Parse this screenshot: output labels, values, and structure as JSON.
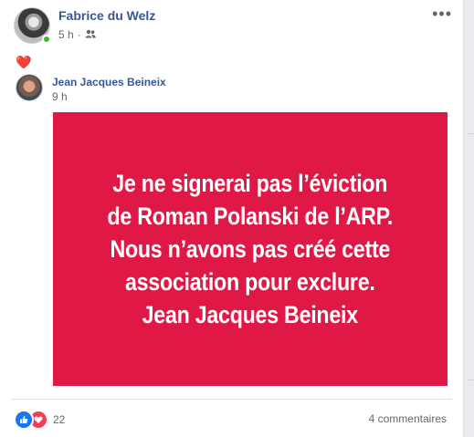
{
  "post": {
    "author": "Fabrice du Welz",
    "time": "5 h",
    "separator": "·",
    "audience_icon": "friends-icon",
    "more_label": "•••",
    "status_emoji": "❤️"
  },
  "shared": {
    "author": "Jean Jacques Beineix",
    "time": "9 h",
    "card_color": "#e01845",
    "quote_lines": [
      "Je ne signerai pas l’éviction",
      "de Roman Polanski de l’ARP.",
      "Nous n’avons pas créé cette",
      "association pour exclure.",
      "Jean Jacques Beineix"
    ]
  },
  "footer": {
    "reactions": [
      "like-icon",
      "love-icon"
    ],
    "reaction_count": "22",
    "comments": "4 commentaires"
  },
  "colors": {
    "link": "#365899",
    "meta": "#616770",
    "like": "#1877f2",
    "love": "#f33e58",
    "online": "#42b72a"
  }
}
